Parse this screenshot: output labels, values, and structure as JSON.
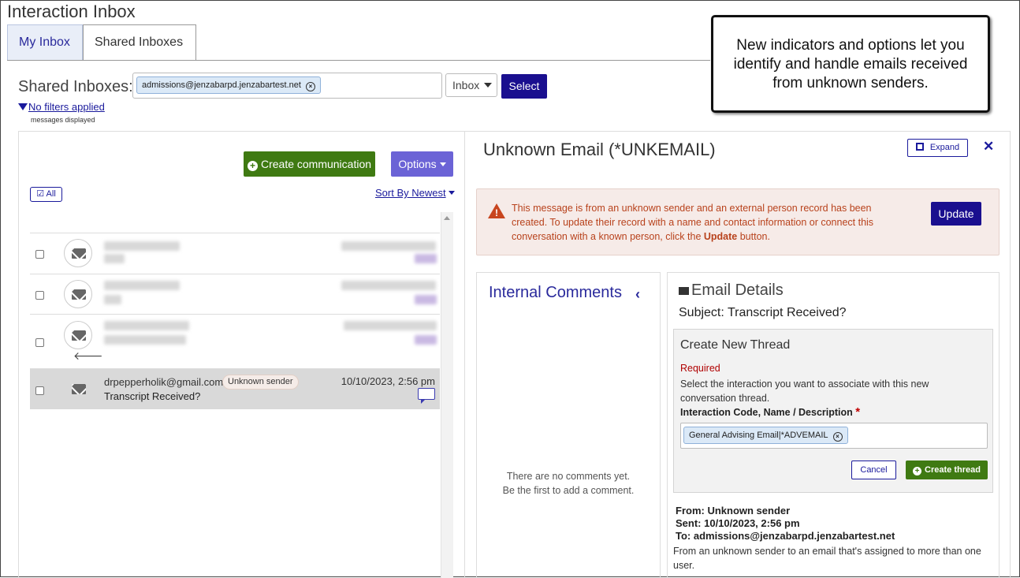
{
  "app": {
    "title": "Interaction Inbox"
  },
  "tabs": [
    {
      "label": "My Inbox"
    },
    {
      "label": "Shared Inboxes"
    }
  ],
  "shared": {
    "label": "Shared Inboxes:",
    "selected_inbox": "admissions@jenzabarpd.jenzabartest.net",
    "folder": "Inbox",
    "select_button": "Select",
    "filters_link": "No filters applied",
    "messages_displayed": "messages displayed"
  },
  "callout": {
    "text": "New indicators and options let you identify and handle emails received from unknown senders."
  },
  "list": {
    "create_button": "Create communication",
    "options_button": "Options",
    "select_all": "All",
    "sort": "Sort By Newest",
    "selected_item": {
      "sender": "drpepperholik@gmail.com",
      "badge": "Unknown sender",
      "date": "10/10/2023, 2:56 pm",
      "subject": "Transcript Received?"
    }
  },
  "detail": {
    "title": "Unknown Email (*UNKEMAIL)",
    "expand_button": "Expand",
    "alert": {
      "text_before": "This message is from an unknown sender and an external person record has been created. To update their record with a name and contact information or connect this conversation with a known person, click the ",
      "text_bold": "Update",
      "text_after": " button.",
      "update_button": "Update"
    },
    "comments": {
      "title": "Internal Comments",
      "empty_line1": "There are no comments yet.",
      "empty_line2": "Be the first to add a comment."
    },
    "email_details": {
      "title": "Email Details",
      "subject": "Subject: Transcript Received?",
      "thread": {
        "title": "Create New Thread",
        "required": "Required",
        "description": "Select the interaction you want to associate with this new conversation thread.",
        "code_label": "Interaction Code, Name / Description",
        "selected_code": "General Advising Email|*ADVEMAIL",
        "cancel_button": "Cancel",
        "create_button": "Create thread"
      },
      "from": "From: Unknown sender",
      "sent": "Sent: 10/10/2023, 2:56 pm",
      "to": "To: admissions@jenzabarpd.jenzabartest.net",
      "body": "From an unknown sender to an email that's assigned to more than one user."
    }
  },
  "colors": {
    "primary": "#1a0f8f",
    "success": "#3f7a12",
    "options": "#6b63d6",
    "alert_text": "#b8421c",
    "alert_bg": "#f6ebe8"
  }
}
